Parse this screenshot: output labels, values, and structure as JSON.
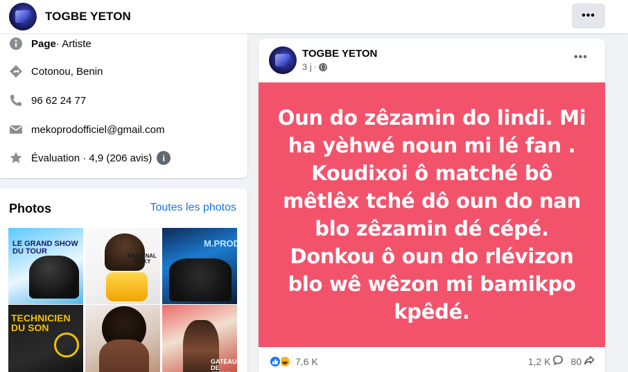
{
  "header": {
    "page_name": "TOGBE YETON",
    "more_label": "•••"
  },
  "intro": {
    "category_strong": "Page",
    "category_rest": " · Artiste",
    "location": "Cotonou, Benin",
    "phone": "96 62 24 77",
    "email": "mekoprodofficiel@gmail.com",
    "rating": "Évaluation · 4,9 (206 avis)",
    "info_badge": "i"
  },
  "photos": {
    "title": "Photos",
    "all_link": "Toutes les photos",
    "thumb_texts": [
      "LE GRAND SHOW DU TOUR",
      "KARDINAL RICKY",
      "M.PROD",
      "TECHNICIEN DU SON",
      "",
      "GATEAU DE JESUS"
    ]
  },
  "post": {
    "author": "TOGBE YETON",
    "time": "3 j",
    "separator": "·",
    "more_label": "•••",
    "text": "Oun do zêzamin do lindi. Mi ha yèhwé noun mi lé fan . Koudixoi ô matché bô mêtlêx tché dô oun do nan blo zêzamin dé cépé. Donkou ô oun do rlévizon blo wê wêzon mi bamikpo kpêdé.",
    "background_color": "#f2536b",
    "reaction_count": "7,6 K",
    "comment_count": "1,2 K",
    "share_count": "80"
  },
  "colors": {
    "link": "#1b74e4",
    "like_blue": "#1877f2",
    "haha_yellow": "#f7b125"
  },
  "icons": [
    "info-icon",
    "directions-icon",
    "phone-icon",
    "email-icon",
    "star-icon",
    "globe-icon",
    "like-icon",
    "haha-icon",
    "comment-icon",
    "share-icon"
  ]
}
